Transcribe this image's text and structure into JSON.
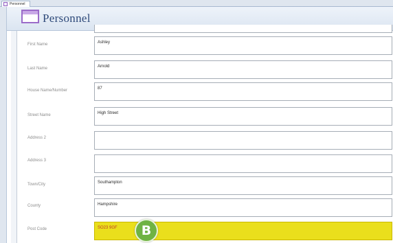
{
  "window": {
    "tab_label": "Personnel"
  },
  "form": {
    "title": "Personnel",
    "top_value": "",
    "fields": [
      {
        "label": "First Name",
        "value": "Ashley"
      },
      {
        "label": "Last Name",
        "value": "Arnold"
      },
      {
        "label": "House Name/Number",
        "value": "87"
      },
      {
        "label": "Street Name",
        "value": "High Street"
      },
      {
        "label": "Address 2",
        "value": ""
      },
      {
        "label": "Address 3",
        "value": ""
      },
      {
        "label": "Town/City",
        "value": "Southampton"
      },
      {
        "label": "County",
        "value": "Hampshire"
      },
      {
        "label": "Post Code",
        "value": "SO23 9GF"
      }
    ]
  },
  "callout": {
    "letter": "B"
  },
  "colors": {
    "active_field": "#eadf1c",
    "callout": "#6fb343",
    "title": "#2f4a7a"
  },
  "icons": {
    "tab": "form-icon",
    "header": "form-icon"
  }
}
